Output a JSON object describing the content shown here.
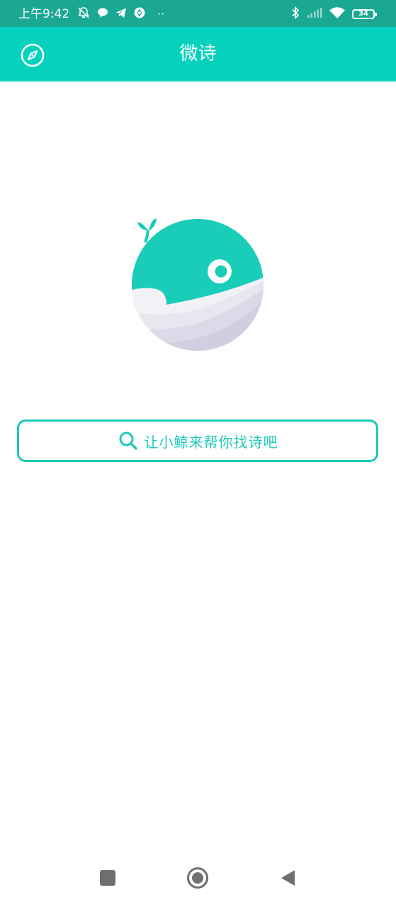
{
  "status_bar": {
    "time": "上午9:42",
    "battery": "34",
    "extra_indicator": "··"
  },
  "app_bar": {
    "title": "微诗",
    "left_icon": "compass-icon"
  },
  "logo": {
    "icon": "whale-logo"
  },
  "search": {
    "placeholder": "让小鲸来帮你找诗吧",
    "icon": "search-icon"
  },
  "colors": {
    "status_bar": "#1aa893",
    "app_bar": "#06d1bd",
    "accent": "#1cc9b8",
    "background": "#ffffff"
  },
  "nav_bar": {
    "buttons": [
      "recents-button",
      "home-button",
      "back-button"
    ]
  }
}
